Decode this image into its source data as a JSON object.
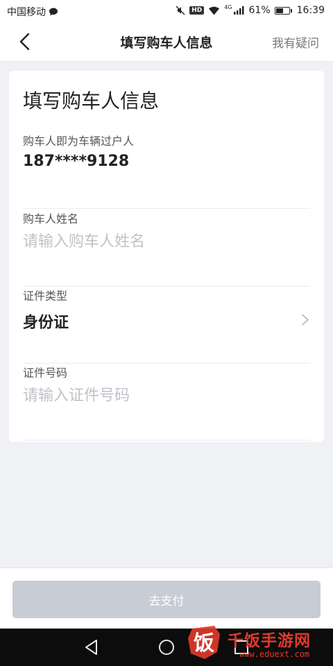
{
  "status_bar": {
    "carrier": "中国移动",
    "hd": "HD",
    "network": "4G",
    "battery": "61%",
    "battery_level": 0.61,
    "time": "16:39"
  },
  "nav": {
    "title": "填写购车人信息",
    "help": "我有疑问"
  },
  "form": {
    "title": "填写购车人信息",
    "fields": [
      {
        "label": "购车人即为车辆过户人",
        "value": "187****9128"
      },
      {
        "label": "购车人姓名",
        "value": "",
        "placeholder": "请输入购车人姓名"
      },
      {
        "label": "证件类型",
        "value": "身份证"
      },
      {
        "label": "证件号码",
        "value": "",
        "placeholder": "请输入证件号码"
      }
    ]
  },
  "actions": {
    "pay_label": "去支付"
  },
  "watermark": {
    "logo_char": "饭",
    "text": "千饭手游网",
    "url": "www.eduext.com"
  },
  "colors": {
    "background": "#f0f1f5",
    "button_disabled": "#c8ccd4",
    "placeholder": "#bfc2c8",
    "watermark": "#e0392c"
  }
}
